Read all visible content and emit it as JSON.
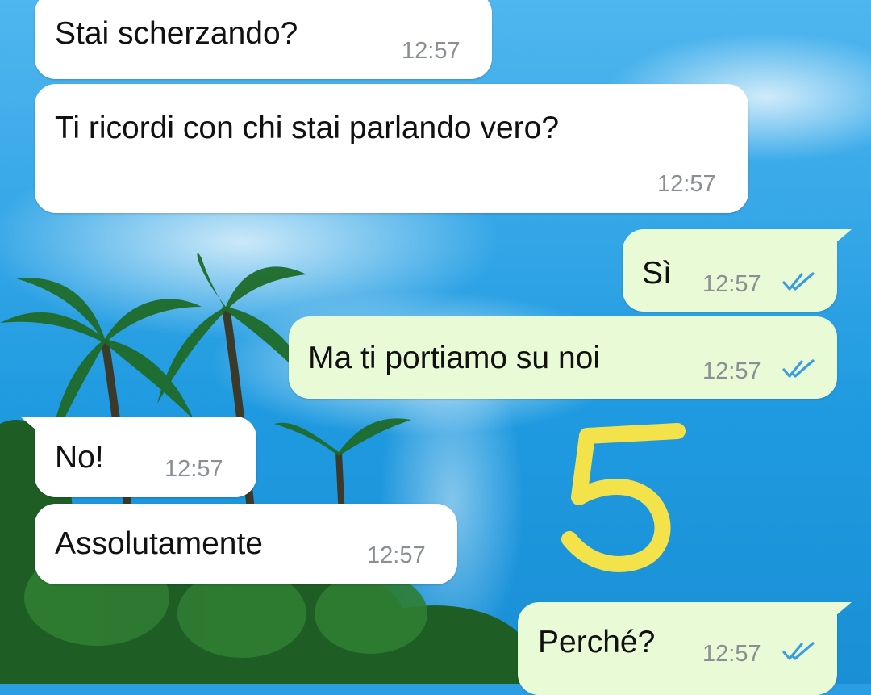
{
  "colors": {
    "incoming_bubble": "#ffffff",
    "outgoing_bubble": "#e8fbd6",
    "read_ticks": "#3b9de0",
    "annotation": "#f4e24a"
  },
  "messages": [
    {
      "direction": "incoming",
      "text": "Stai scherzando?",
      "time": "12:57"
    },
    {
      "direction": "incoming",
      "text": "Ti ricordi con chi stai parlando vero?",
      "time": "12:57"
    },
    {
      "direction": "outgoing",
      "text": "Sì",
      "time": "12:57",
      "status": "read-double-check-icon"
    },
    {
      "direction": "outgoing",
      "text": "Ma ti portiamo su noi",
      "time": "12:57",
      "status": "read-double-check-icon"
    },
    {
      "direction": "incoming",
      "text": "No!",
      "time": "12:57"
    },
    {
      "direction": "incoming",
      "text": "Assolutamente",
      "time": "12:57"
    },
    {
      "direction": "outgoing",
      "text": "Perché?",
      "time": "12:57",
      "status": "read-double-check-icon"
    }
  ],
  "annotation": {
    "text": "5"
  }
}
